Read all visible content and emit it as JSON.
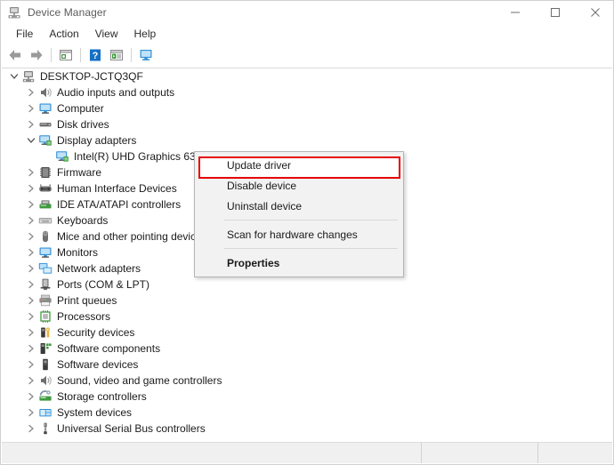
{
  "window": {
    "title": "Device Manager",
    "icon": "device-manager-icon",
    "controls": {
      "minimize": "minimize-icon",
      "maximize": "maximize-icon",
      "close": "close-icon"
    }
  },
  "menubar": {
    "items": [
      {
        "label": "File"
      },
      {
        "label": "Action"
      },
      {
        "label": "View"
      },
      {
        "label": "Help"
      }
    ]
  },
  "toolbar": {
    "buttons": [
      {
        "name": "back-icon",
        "title": "Back"
      },
      {
        "name": "forward-icon",
        "title": "Forward"
      },
      {
        "name": "properties-icon",
        "title": "Properties"
      },
      {
        "name": "help-icon",
        "title": "Help"
      },
      {
        "name": "update-driver-icon",
        "title": "Update Driver Software"
      },
      {
        "name": "scan-hardware-icon",
        "title": "Scan for hardware changes"
      }
    ]
  },
  "tree": {
    "items": [
      {
        "label": "DESKTOP-JCTQ3QF",
        "level": 0,
        "state": "expanded",
        "icon": "computer-root-icon"
      },
      {
        "label": "Audio inputs and outputs",
        "level": 1,
        "state": "collapsed",
        "icon": "speaker-icon"
      },
      {
        "label": "Computer",
        "level": 1,
        "state": "collapsed",
        "icon": "monitor-icon"
      },
      {
        "label": "Disk drives",
        "level": 1,
        "state": "collapsed",
        "icon": "disk-icon"
      },
      {
        "label": "Display adapters",
        "level": 1,
        "state": "expanded",
        "icon": "display-adapter-icon"
      },
      {
        "label": "Intel(R) UHD Graphics 630",
        "level": 2,
        "state": "leaf",
        "icon": "display-adapter-icon"
      },
      {
        "label": "Firmware",
        "level": 1,
        "state": "collapsed",
        "icon": "firmware-icon"
      },
      {
        "label": "Human Interface Devices",
        "level": 1,
        "state": "collapsed",
        "icon": "hid-icon"
      },
      {
        "label": "IDE ATA/ATAPI controllers",
        "level": 1,
        "state": "collapsed",
        "icon": "ide-icon"
      },
      {
        "label": "Keyboards",
        "level": 1,
        "state": "collapsed",
        "icon": "keyboard-icon"
      },
      {
        "label": "Mice and other pointing devices",
        "level": 1,
        "state": "collapsed",
        "icon": "mouse-icon"
      },
      {
        "label": "Monitors",
        "level": 1,
        "state": "collapsed",
        "icon": "monitor-icon"
      },
      {
        "label": "Network adapters",
        "level": 1,
        "state": "collapsed",
        "icon": "network-icon"
      },
      {
        "label": "Ports (COM & LPT)",
        "level": 1,
        "state": "collapsed",
        "icon": "port-icon"
      },
      {
        "label": "Print queues",
        "level": 1,
        "state": "collapsed",
        "icon": "printer-icon"
      },
      {
        "label": "Processors",
        "level": 1,
        "state": "collapsed",
        "icon": "processor-icon"
      },
      {
        "label": "Security devices",
        "level": 1,
        "state": "collapsed",
        "icon": "security-icon"
      },
      {
        "label": "Software components",
        "level": 1,
        "state": "collapsed",
        "icon": "software-component-icon"
      },
      {
        "label": "Software devices",
        "level": 1,
        "state": "collapsed",
        "icon": "software-device-icon"
      },
      {
        "label": "Sound, video and game controllers",
        "level": 1,
        "state": "collapsed",
        "icon": "speaker-icon"
      },
      {
        "label": "Storage controllers",
        "level": 1,
        "state": "collapsed",
        "icon": "storage-icon"
      },
      {
        "label": "System devices",
        "level": 1,
        "state": "collapsed",
        "icon": "system-device-icon"
      },
      {
        "label": "Universal Serial Bus controllers",
        "level": 1,
        "state": "collapsed",
        "icon": "usb-icon"
      }
    ]
  },
  "context_menu": {
    "items": [
      {
        "label": "Update driver",
        "type": "item",
        "highlighted": true,
        "bold": false
      },
      {
        "label": "Disable device",
        "type": "item",
        "highlighted": false,
        "bold": false
      },
      {
        "label": "Uninstall device",
        "type": "item",
        "highlighted": false,
        "bold": false
      },
      {
        "type": "separator"
      },
      {
        "label": "Scan for hardware changes",
        "type": "item",
        "highlighted": false,
        "bold": false
      },
      {
        "type": "separator"
      },
      {
        "label": "Properties",
        "type": "item",
        "highlighted": false,
        "bold": true
      }
    ],
    "highlight_color": "#e60000"
  },
  "statusbar": {
    "segments": [
      "",
      "",
      ""
    ]
  }
}
